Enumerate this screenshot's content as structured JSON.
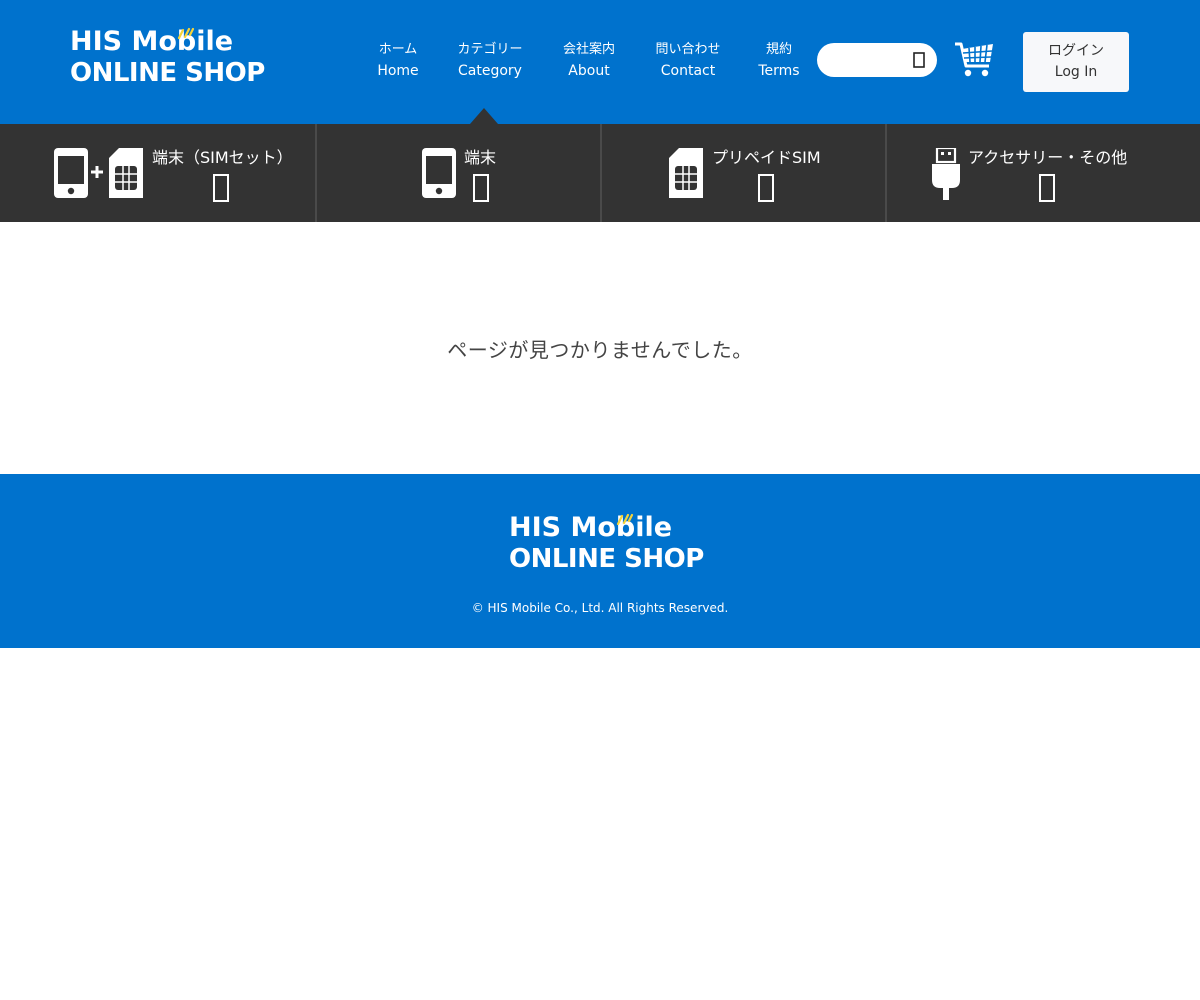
{
  "header": {
    "logo_line1": "HIS Mobile",
    "logo_line2": "ONLINE SHOP",
    "nav": [
      {
        "jp": "ホーム",
        "en": "Home"
      },
      {
        "jp": "カテゴリー",
        "en": "Category"
      },
      {
        "jp": "会社案内",
        "en": "About"
      },
      {
        "jp": "問い合わせ",
        "en": "Contact"
      },
      {
        "jp": "規約",
        "en": "Terms"
      }
    ],
    "search_placeholder": "",
    "login": {
      "jp": "ログイン",
      "en": "Log In"
    }
  },
  "categories": [
    {
      "label": "端末（SIMセット）",
      "icon": "phone-plus-sim-icon"
    },
    {
      "label": "端末",
      "icon": "phone-icon"
    },
    {
      "label": "プリペイドSIM",
      "icon": "sim-card-icon"
    },
    {
      "label": "アクセサリー・その他",
      "icon": "usb-icon"
    }
  ],
  "main": {
    "message": "ページが見つかりませんでした。"
  },
  "footer": {
    "logo_line1": "HIS Mobile",
    "logo_line2": "ONLINE SHOP",
    "copyright": "© HIS Mobile Co., Ltd. All Rights Reserved."
  },
  "colors": {
    "brand_blue": "#0072cd",
    "category_bar": "#333333",
    "accent_yellow": "#f5d43a"
  }
}
